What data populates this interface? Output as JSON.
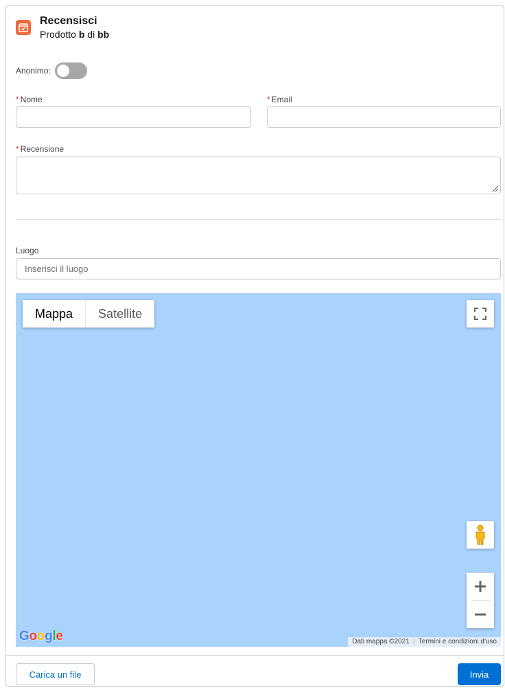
{
  "header": {
    "title": "Recensisci",
    "subtitle_prefix": "Prodotto ",
    "product": "b",
    "subtitle_mid": " di ",
    "vendor": "bb",
    "icon": "calendar-check-icon",
    "icon_color": "#f06a3c"
  },
  "form": {
    "anonymous_label": "Anonimo:",
    "anonymous_value": false,
    "required_mark": "*",
    "name_label": "Nome",
    "name_value": "",
    "email_label": "Email",
    "email_value": "",
    "review_label": "Recensione",
    "review_value": "",
    "location_label": "Luogo",
    "location_placeholder": "Inserisci il luogo"
  },
  "map": {
    "type_map": "Mappa",
    "type_satellite": "Satellite",
    "active_type": "Mappa",
    "logo_letters": [
      "G",
      "o",
      "o",
      "g",
      "l",
      "e"
    ],
    "logo_colors": [
      "#4285f4",
      "#ea4335",
      "#fbbc05",
      "#4285f4",
      "#34a853",
      "#ea4335"
    ],
    "attribution_data": "Dati mappa ©2021",
    "attribution_terms": "Termini e condizioni d'uso",
    "water_color": "#aad3fc"
  },
  "footer": {
    "upload_label": "Carica un file",
    "submit_label": "Invia",
    "accent_color": "#0070d2"
  }
}
